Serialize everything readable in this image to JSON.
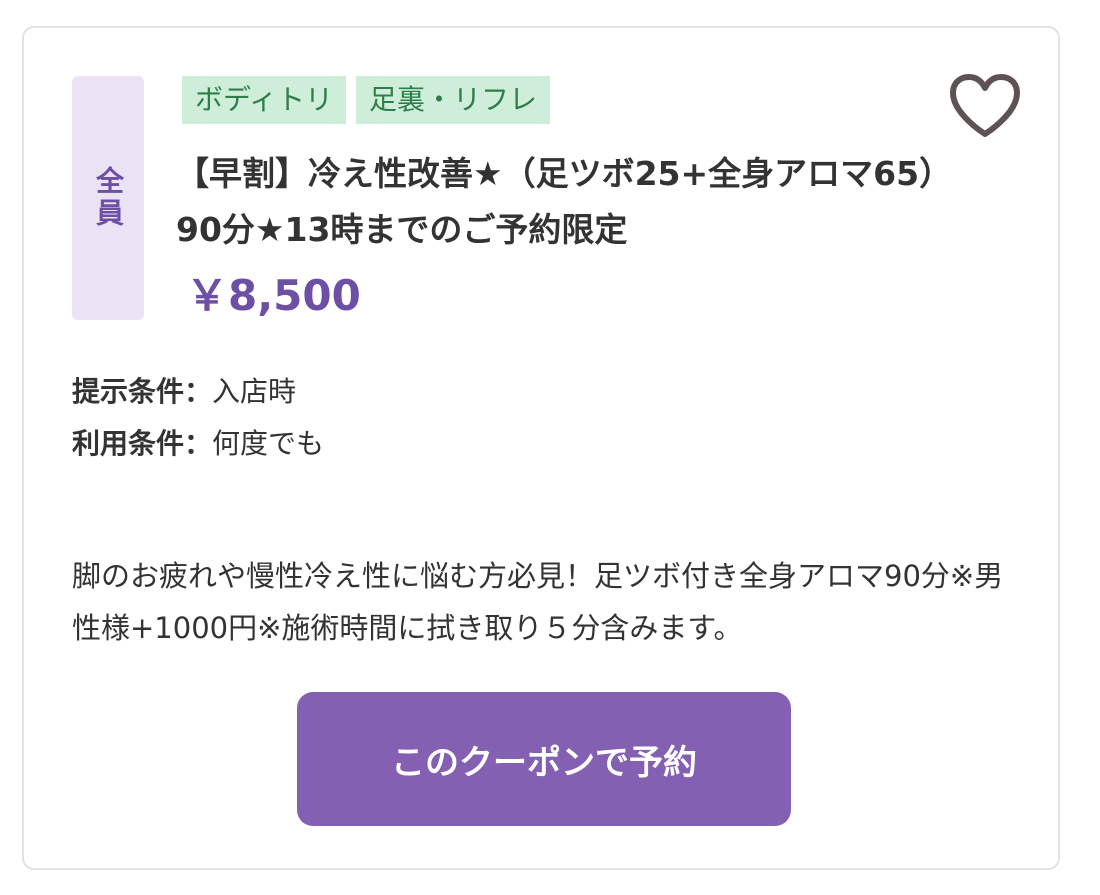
{
  "coupon": {
    "member_badge": "全員",
    "tags": [
      "ボディトリ",
      "足裏・リフレ"
    ],
    "title": "【早割】冷え性改善★（足ツボ25+全身アロマ65）90分★13時までのご予約限定",
    "price": "￥8,500",
    "conditions": [
      {
        "label": "提示条件：",
        "value": "入店時"
      },
      {
        "label": "利用条件：",
        "value": "何度でも"
      }
    ],
    "description": "脚のお疲れや慢性冷え性に悩む方必見！足ツボ付き全身アロマ90分※男性様+1000円※施術時間に拭き取り５分含みます。",
    "button_label": "このクーポンで予約",
    "favorite_icon": "heart-outline-icon"
  },
  "colors": {
    "accent_purple": "#8460b3",
    "price_purple": "#6e4fa6",
    "badge_bg": "#ebe3f5",
    "tag_bg": "#cfeed9",
    "tag_text": "#2f7d4a",
    "heart_stroke": "#5e5352"
  }
}
